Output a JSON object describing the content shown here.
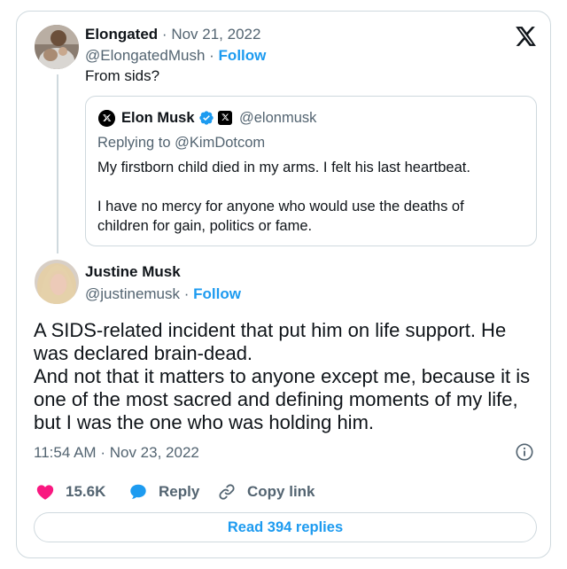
{
  "colors": {
    "accent": "#1d9bf0",
    "muted": "#536471",
    "like": "#f91880",
    "border": "#cfd9de",
    "text": "#0f1419"
  },
  "icons": {
    "brand": "x-logo-icon",
    "verified": "verified-badge-icon",
    "like": "heart-icon",
    "reply": "speech-bubble-icon",
    "copy": "link-icon",
    "info": "info-icon"
  },
  "parent_tweet": {
    "author_name": "Elongated",
    "separator": "·",
    "date": "Nov 21, 2022",
    "handle": "@ElongatedMush",
    "follow_label": "Follow",
    "text": "From sids?"
  },
  "quoted_tweet": {
    "author_name": "Elon Musk",
    "handle": "@elonmusk",
    "replying_prefix": "Replying to",
    "replying_to": "@KimDotcom",
    "paragraph_1": "My firstborn child died in my arms. I felt his last heartbeat.",
    "paragraph_2": "I have no mercy for anyone who would use the deaths of children for gain, politics or fame."
  },
  "main_tweet": {
    "author_name": "Justine Musk",
    "handle": "@justinemusk",
    "follow_label": "Follow",
    "line_1": "A SIDS-related incident that put him on life support. He was declared brain-dead.",
    "line_2": "And not that it matters to anyone except me, because it is one of the most sacred and defining moments of my life, but I was the one who was holding him.",
    "time": "11:54 AM",
    "date": "Nov 23, 2022"
  },
  "actions": {
    "like_count": "15.6K",
    "reply_label": "Reply",
    "copy_label": "Copy link",
    "read_replies_label": "Read 394 replies"
  }
}
